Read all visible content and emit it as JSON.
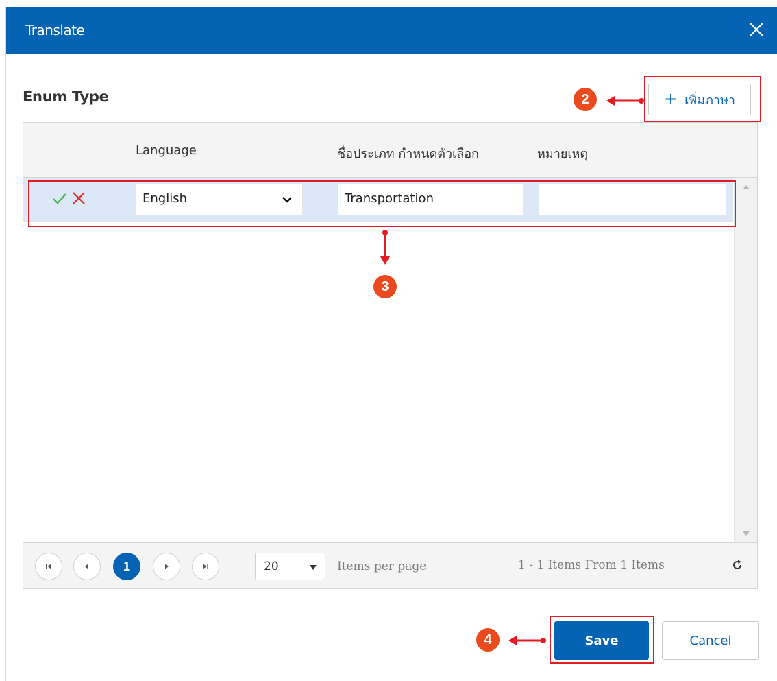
{
  "dialog": {
    "title": "Translate",
    "close_icon": "close-icon"
  },
  "section": {
    "title": "Enum Type"
  },
  "toolbar": {
    "add_language_plus": "+",
    "add_language_label": "เพิ่มภาษา"
  },
  "grid": {
    "columns": [
      "Language",
      "ชื่อประเภท กำหนดตัวเลือก",
      "หมายเหตุ"
    ],
    "rows": [
      {
        "language": "English",
        "name": "Transportation",
        "note": ""
      }
    ]
  },
  "pager": {
    "current_page": "1",
    "page_size": "20",
    "items_per_page_label": "Items per page",
    "items_info": "1 - 1 Items From 1 Items"
  },
  "footer": {
    "save_label": "Save",
    "cancel_label": "Cancel"
  },
  "annotations": {
    "step_2": "2",
    "step_3": "3",
    "step_4": "4",
    "color": "#e31b23",
    "badge_color": "#ea4a1d"
  },
  "colors": {
    "primary": "#0563b3",
    "row_selected": "#dce8f8",
    "confirm_green": "#3cb34a",
    "cancel_red": "#e02b2b"
  }
}
